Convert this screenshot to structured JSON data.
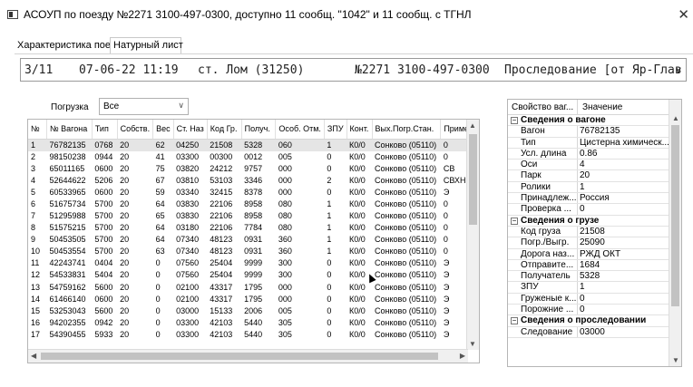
{
  "window": {
    "title": "АСОУП по поезду №2271 3100-497-0300, доступно 11 сообщ. \"1042\" и 11 сообщ. с ТГНЛ",
    "close_glyph": "✕"
  },
  "tabs": [
    {
      "label": "Характеристика поезда",
      "active": false
    },
    {
      "label": "Натурный лист",
      "active": true
    }
  ],
  "infobar": {
    "index": "3/11",
    "datetime": "07-06-22 11:19",
    "station": "ст. Лом (31250)",
    "train": "№2271 3100-497-0300",
    "follow": "Проследование [от Яр-Глав"
  },
  "filter": {
    "label": "Погрузка",
    "value": "Все"
  },
  "grid": {
    "columns": [
      "№",
      "№ Вагона",
      "Тип",
      "Собств.",
      "Вес",
      "Ст. Наз",
      "Код Гр.",
      "Получ.",
      "Особ. Отм.",
      "ЗПУ",
      "Конт.",
      "Вых.Погр.Стан.",
      "Примеч."
    ],
    "rows": [
      [
        "1",
        "76782135",
        "0768",
        "20",
        "62",
        "04250",
        "21508",
        "5328",
        "060",
        "1",
        "К0/0",
        "Сонково (05110)",
        "0"
      ],
      [
        "2",
        "98150238",
        "0944",
        "20",
        "41",
        "03300",
        "00300",
        "0012",
        "005",
        "0",
        "К0/0",
        "Сонково (05110)",
        "0"
      ],
      [
        "3",
        "65011165",
        "0600",
        "20",
        "75",
        "03820",
        "24212",
        "9757",
        "000",
        "0",
        "К0/0",
        "Сонково (05110)",
        "СВ"
      ],
      [
        "4",
        "52644622",
        "5206",
        "20",
        "67",
        "03810",
        "53103",
        "3346",
        "000",
        "2",
        "К0/0",
        "Сонково (05110)",
        "СВХН"
      ],
      [
        "5",
        "60533965",
        "0600",
        "20",
        "59",
        "03340",
        "32415",
        "8378",
        "000",
        "0",
        "К0/0",
        "Сонково (05110)",
        "Э"
      ],
      [
        "6",
        "51675734",
        "5700",
        "20",
        "64",
        "03830",
        "22106",
        "8958",
        "080",
        "1",
        "К0/0",
        "Сонково (05110)",
        "0"
      ],
      [
        "7",
        "51295988",
        "5700",
        "20",
        "65",
        "03830",
        "22106",
        "8958",
        "080",
        "1",
        "К0/0",
        "Сонково (05110)",
        "0"
      ],
      [
        "8",
        "51575215",
        "5700",
        "20",
        "64",
        "03180",
        "22106",
        "7784",
        "080",
        "1",
        "К0/0",
        "Сонково (05110)",
        "0"
      ],
      [
        "9",
        "50453505",
        "5700",
        "20",
        "64",
        "07340",
        "48123",
        "0931",
        "360",
        "1",
        "К0/0",
        "Сонково (05110)",
        "0"
      ],
      [
        "10",
        "50453554",
        "5700",
        "20",
        "63",
        "07340",
        "48123",
        "0931",
        "360",
        "1",
        "К0/0",
        "Сонково (05110)",
        "0"
      ],
      [
        "11",
        "42243741",
        "0404",
        "20",
        "0",
        "07560",
        "25404",
        "9999",
        "300",
        "0",
        "К0/0",
        "Сонково (05110)",
        "Э"
      ],
      [
        "12",
        "54533831",
        "5404",
        "20",
        "0",
        "07560",
        "25404",
        "9999",
        "300",
        "0",
        "К0/0",
        "Сонково (05110)",
        "Э"
      ],
      [
        "13",
        "54759162",
        "5600",
        "20",
        "0",
        "02100",
        "43317",
        "1795",
        "000",
        "0",
        "К0/0",
        "Сонково (05110)",
        "Э"
      ],
      [
        "14",
        "61466140",
        "0600",
        "20",
        "0",
        "02100",
        "43317",
        "1795",
        "000",
        "0",
        "К0/0",
        "Сонково (05110)",
        "Э"
      ],
      [
        "15",
        "53253043",
        "5600",
        "20",
        "0",
        "03000",
        "15133",
        "2006",
        "005",
        "0",
        "К0/0",
        "Сонково (05110)",
        "Э"
      ],
      [
        "16",
        "94202355",
        "0942",
        "20",
        "0",
        "03300",
        "42103",
        "5440",
        "305",
        "0",
        "К0/0",
        "Сонково (05110)",
        "Э"
      ],
      [
        "17",
        "54390455",
        "5933",
        "20",
        "0",
        "03300",
        "42103",
        "5440",
        "305",
        "0",
        "К0/0",
        "Сонково (05110)",
        "Э"
      ]
    ]
  },
  "props": {
    "headers": [
      "Свойство ваг...",
      "Значение"
    ],
    "rows": [
      {
        "section": true,
        "label": "Сведения о вагоне"
      },
      {
        "section": false,
        "key": "Вагон",
        "value": "76782135"
      },
      {
        "section": false,
        "key": "Тип",
        "value": "Цистерна химическ..."
      },
      {
        "section": false,
        "key": "Усл. длина",
        "value": "0.86"
      },
      {
        "section": false,
        "key": "Оси",
        "value": "4"
      },
      {
        "section": false,
        "key": "Парк",
        "value": "20"
      },
      {
        "section": false,
        "key": "Ролики",
        "value": "1"
      },
      {
        "section": false,
        "key": "Принадлеж...",
        "value": "Россия"
      },
      {
        "section": false,
        "key": "Проверка ...",
        "value": "0"
      },
      {
        "section": true,
        "label": "Сведения о грузе"
      },
      {
        "section": false,
        "key": "Код груза",
        "value": "21508"
      },
      {
        "section": false,
        "key": "Погр./Выгр.",
        "value": "25090"
      },
      {
        "section": false,
        "key": "Дорога наз...",
        "value": "РЖД ОКТ"
      },
      {
        "section": false,
        "key": "Отправите...",
        "value": "1684"
      },
      {
        "section": false,
        "key": "Получатель",
        "value": "5328"
      },
      {
        "section": false,
        "key": "ЗПУ",
        "value": "1"
      },
      {
        "section": false,
        "key": "Груженые к...",
        "value": "0"
      },
      {
        "section": false,
        "key": "Порожние ...",
        "value": "0"
      },
      {
        "section": true,
        "label": "Сведения о проследовании"
      },
      {
        "section": false,
        "key": "Следование",
        "value": "03000"
      }
    ]
  },
  "colors": {
    "selected_row": "#e5e5e5",
    "border": "#b5b5b5",
    "scroll_thumb": "#c2c2c2"
  },
  "icons": {
    "window_icon": "app-window-icon",
    "dropdown": "chevron-down-icon",
    "collapse": "minus-box-icon"
  }
}
